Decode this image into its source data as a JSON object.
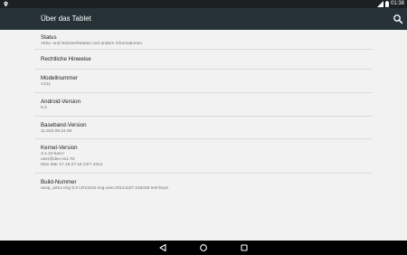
{
  "status_bar": {
    "time": "01:38",
    "left_icon": "location-pin-icon",
    "icons": [
      "signal-icon",
      "battery-icon"
    ]
  },
  "action_bar": {
    "title": "Über das Tablet",
    "search_icon": "search-icon"
  },
  "items": [
    {
      "title": "Status",
      "lines": [
        "Akku- und Netzwerkstatus und andere Informationen"
      ]
    },
    {
      "title": "Rechtliche Hinweise",
      "lines": []
    },
    {
      "title": "Modellnummer",
      "lines": [
        "A211"
      ]
    },
    {
      "title": "Android-Version",
      "lines": [
        "5.0"
      ]
    },
    {
      "title": "Baseband-Version",
      "lines": [
        "11.810.09.24.00"
      ]
    },
    {
      "title": "Kernel-Version",
      "lines": [
        "3.1.10-tiam+",
        "user@dev-vx1 #2",
        "Mon Mär 17 16:27:16 CET 2014"
      ]
    },
    {
      "title": "Build-Nummer",
      "lines": [
        "aosp_a211-eng 5.0 LRX21M eng.user.20141107.155336 test-keys"
      ]
    }
  ],
  "nav_bar": {
    "buttons": [
      "back-icon",
      "home-icon",
      "recents-icon"
    ]
  },
  "colors": {
    "status_bar": "#1c2021",
    "action_bar": "#263238",
    "background": "#f2f2f2",
    "divider": "#dcdcdc",
    "nav_bar": "#000000"
  }
}
